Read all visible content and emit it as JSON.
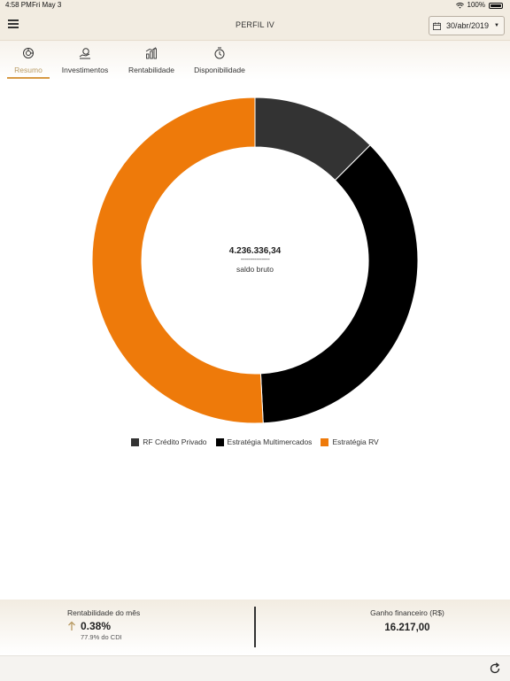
{
  "status_bar": {
    "time": "4:58 PM",
    "date": "Fri May 3",
    "battery": "100%",
    "icons": [
      "wifi-icon",
      "battery-icon"
    ]
  },
  "navbar": {
    "title": "PERFIL IV",
    "menu_icon": "hamburger-menu-icon",
    "date_select": {
      "value": "30/abr/2019",
      "icon": "calendar-icon"
    }
  },
  "tabs": [
    {
      "label": "Resumo",
      "icon": "summary-icon",
      "active": true
    },
    {
      "label": "Investimentos",
      "icon": "investments-icon",
      "active": false
    },
    {
      "label": "Rentabilidade",
      "icon": "bar-chart-icon",
      "active": false
    },
    {
      "label": "Disponibilidade",
      "icon": "availability-icon",
      "active": false
    }
  ],
  "colors": {
    "accent": "#d79a45",
    "active_tab_label": "#b89a63",
    "rv": "#ee7a0a",
    "multimercados": "#000000",
    "credito_privado": "#333333"
  },
  "chart_data": {
    "type": "pie",
    "donut": true,
    "center_value": "4.236.336,34",
    "center_separator": "---------------",
    "center_label": "saldo bruto",
    "slices": [
      {
        "name": "RF Crédito Privado",
        "share": 0.125,
        "color": "#333333"
      },
      {
        "name": "Estratégia Multimercados",
        "share": 0.367,
        "color": "#000000"
      },
      {
        "name": "Estratégia RV",
        "share": 0.508,
        "color": "#ee7a0a"
      }
    ],
    "legend_position": "bottom"
  },
  "footer": {
    "rentabilidade_title": "Rentabilidade do mês",
    "rentabilidade_value": "0.38%",
    "rentabilidade_trend_icon": "arrow-up-icon",
    "cdi_text": "77.9% do CDI",
    "ganho_title": "Ganho financeiro (R$)",
    "ganho_value": "16.217,00"
  },
  "bottom_bar": {
    "refresh_icon": "refresh-icon"
  }
}
